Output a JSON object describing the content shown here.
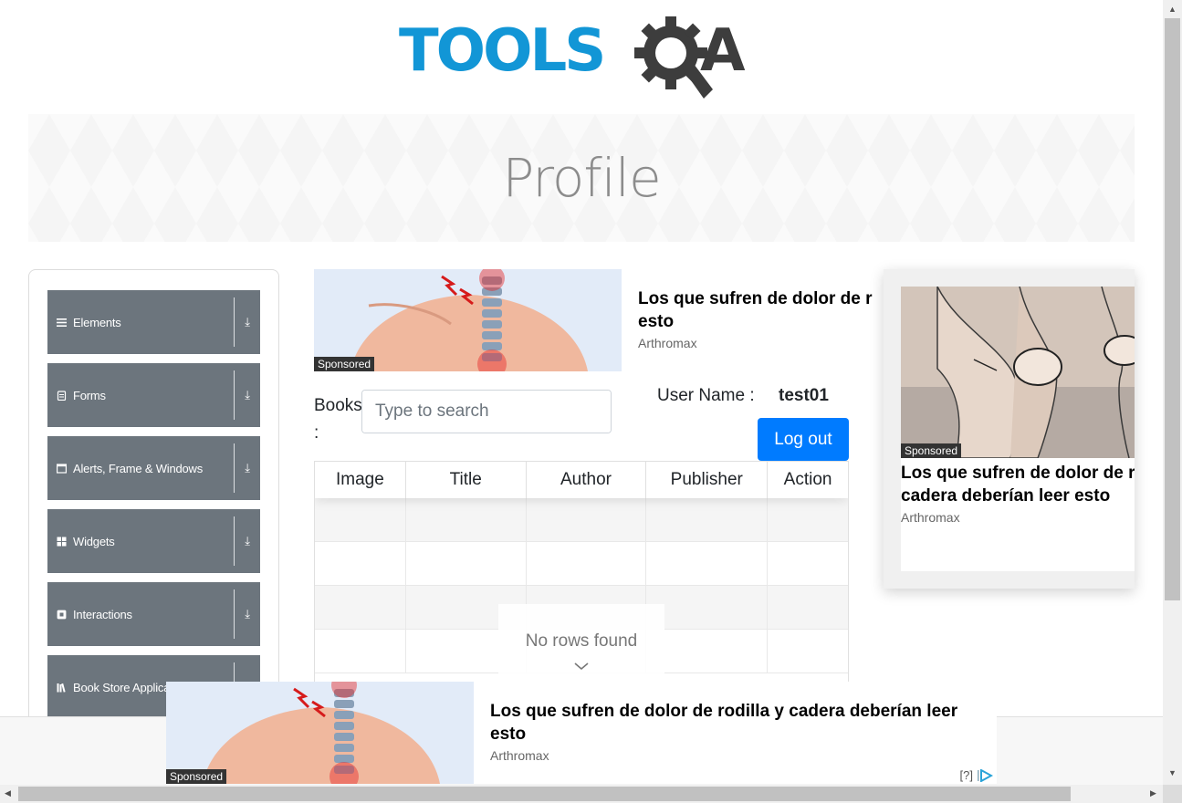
{
  "header": {
    "logo_text": "TOOLS",
    "logo_tail": "A",
    "page_title": "Profile"
  },
  "sidebar": {
    "groups": [
      {
        "label": "Elements",
        "icon": "hamburger-icon"
      },
      {
        "label": "Forms",
        "icon": "document-icon"
      },
      {
        "label": "Alerts, Frame & Windows",
        "icon": "window-icon"
      },
      {
        "label": "Widgets",
        "icon": "grid-icon"
      },
      {
        "label": "Interactions",
        "icon": "square-icon"
      },
      {
        "label": "Book Store Applica",
        "icon": "books-icon"
      }
    ],
    "expand_icon": "download-arrow-icon"
  },
  "ad_top": {
    "title": "Los que sufren de dolor de r esto",
    "source": "Arthromax",
    "sponsored": "Sponsored"
  },
  "books": {
    "label": "Books :",
    "search_placeholder": "Type to search",
    "search_icon": "magnifier-icon"
  },
  "user": {
    "label": "User Name :",
    "value": "test01",
    "logout_label": "Log out"
  },
  "table": {
    "columns": [
      "Image",
      "Title",
      "Author",
      "Publisher",
      "Action"
    ],
    "empty_message": "No rows found"
  },
  "ad_right": {
    "title": "Los que sufren de dolor de roc cadera deberían leer esto",
    "source": "Arthromax",
    "sponsored": "Sponsored"
  },
  "ad_bottom": {
    "title": "Los que sufren de dolor de rodilla y cadera deberían leer esto",
    "source": "Arthromax",
    "sponsored": "Sponsored",
    "info": "[?]"
  },
  "colors": {
    "brand_blue": "#1296d6",
    "sidebar_gray": "#6c757d",
    "button_blue": "#007bff"
  }
}
